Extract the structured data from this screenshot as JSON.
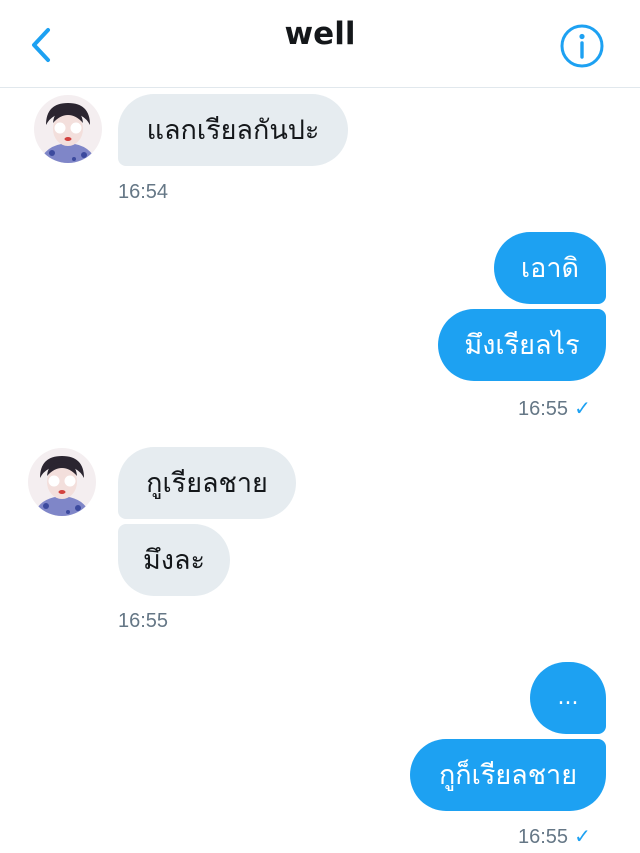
{
  "header": {
    "title": "well",
    "back_icon": "chevron-left-icon",
    "info_icon": "info-circle-icon",
    "accent_color": "#1da1f2"
  },
  "messages": {
    "m1": {
      "text": "แลกเรียลกันปะ",
      "time": "16:54"
    },
    "m2": {
      "text": "เอาดิ"
    },
    "m3": {
      "text": "มึงเรียลไร",
      "time": "16:55",
      "status": "✓"
    },
    "m4": {
      "text": "กูเรียลชาย"
    },
    "m5": {
      "text": "มึงละ",
      "time": "16:55"
    },
    "m6": {
      "text": "..."
    },
    "m7": {
      "text": "กูก็เรียลชาย",
      "time": "16:55",
      "status": "✓"
    }
  },
  "colors": {
    "incoming_bubble": "#e6ecf0",
    "outgoing_bubble": "#1da1f2",
    "timestamp": "#657786"
  }
}
